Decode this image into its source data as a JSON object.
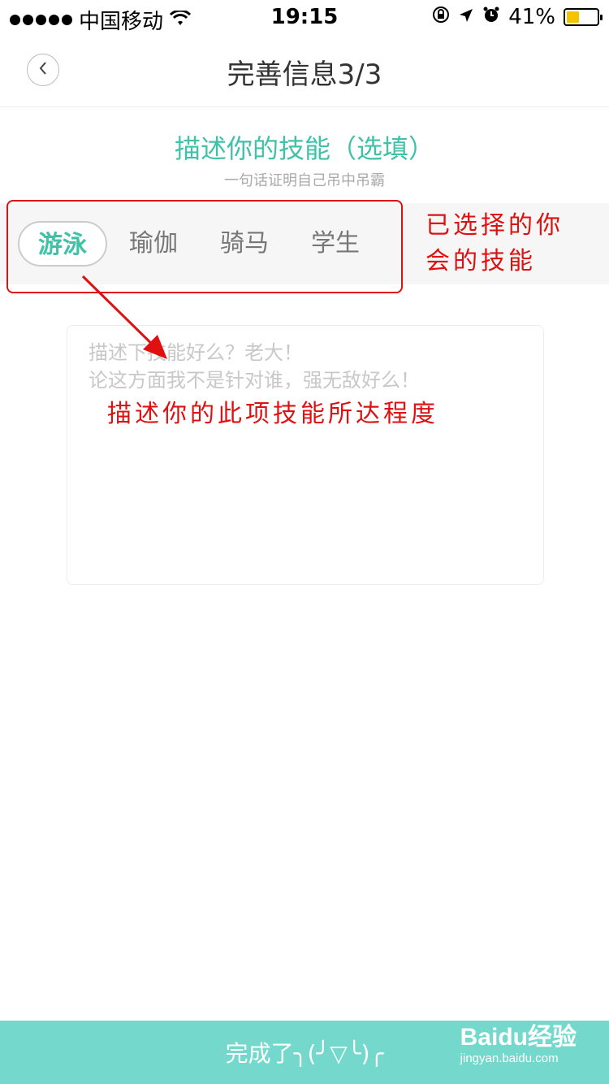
{
  "status_bar": {
    "carrier": "中国移动",
    "time": "19:15",
    "battery": "41%",
    "battery_level": 0.41
  },
  "nav": {
    "title": "完善信息3/3"
  },
  "section": {
    "title": "描述你的技能（选填）",
    "subtitle": "一句话证明自己吊中吊霸"
  },
  "skills": [
    {
      "label": "游泳",
      "selected": true
    },
    {
      "label": "瑜伽",
      "selected": false
    },
    {
      "label": "骑马",
      "selected": false
    },
    {
      "label": "学生",
      "selected": false
    }
  ],
  "annotations": {
    "selected_skills_line1": "已选择的你",
    "selected_skills_line2": "会的技能",
    "describe_level": "描述你的此项技能所达程度"
  },
  "description": {
    "placeholder": "描述下技能好么？老大！\n论这方面我不是针对谁，强无敌好么！"
  },
  "footer": {
    "done_label": "完成了╮(╯▽╰)╭"
  },
  "watermark": {
    "logo": "Baidu经验",
    "url": "jingyan.baidu.com"
  },
  "colors": {
    "accent": "#3fc2a8",
    "button": "#74d9cc",
    "annotation": "#e01010"
  }
}
